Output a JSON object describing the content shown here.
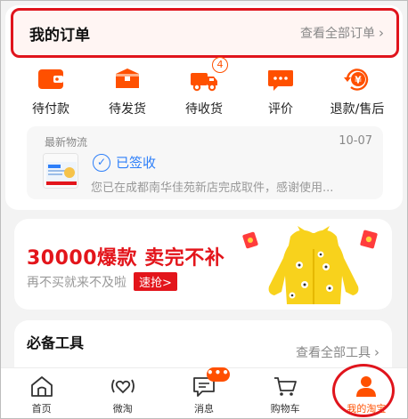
{
  "order": {
    "title": "我的订单",
    "view_all": "查看全部订单",
    "statuses": [
      {
        "label": "待付款",
        "icon": "wallet-icon"
      },
      {
        "label": "待发货",
        "icon": "box-icon"
      },
      {
        "label": "待收货",
        "icon": "truck-icon",
        "badge": "4"
      },
      {
        "label": "评价",
        "icon": "comment-icon"
      },
      {
        "label": "退款/售后",
        "icon": "refund-icon"
      }
    ],
    "logistics": {
      "label": "最新物流",
      "date": "10-07",
      "status": "已签收",
      "desc": "您已在成都南华佳苑新店完成取件，感谢使用..."
    }
  },
  "promo": {
    "headline": "30000爆款  卖完不补",
    "sub": "再不买就来不及啦",
    "button": "速抢>"
  },
  "tools": {
    "title": "必备工具",
    "view_all": "查看全部工具"
  },
  "tabbar": {
    "items": [
      {
        "label": "首页",
        "icon": "home-icon"
      },
      {
        "label": "微淘",
        "icon": "heart-wave-icon"
      },
      {
        "label": "消息",
        "icon": "message-icon",
        "badge": "•••"
      },
      {
        "label": "购物车",
        "icon": "cart-icon"
      },
      {
        "label": "我的淘宝",
        "icon": "user-icon",
        "active": true
      }
    ]
  },
  "colors": {
    "accent": "#ff5000",
    "highlight": "#e0141c",
    "promo_red": "#e3151b",
    "logistics_blue": "#2d7ff9"
  }
}
